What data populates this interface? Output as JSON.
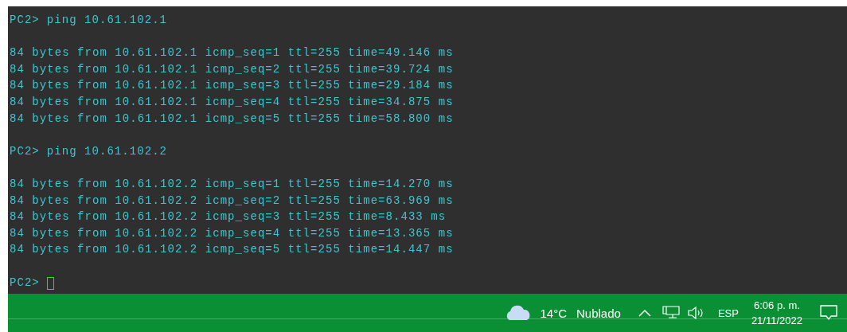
{
  "terminal": {
    "sessions": [
      {
        "prompt": "PC2>",
        "command": "ping 10.61.102.1",
        "replies": [
          "84 bytes from 10.61.102.1 icmp_seq=1 ttl=255 time=49.146 ms",
          "84 bytes from 10.61.102.1 icmp_seq=2 ttl=255 time=39.724 ms",
          "84 bytes from 10.61.102.1 icmp_seq=3 ttl=255 time=29.184 ms",
          "84 bytes from 10.61.102.1 icmp_seq=4 ttl=255 time=34.875 ms",
          "84 bytes from 10.61.102.1 icmp_seq=5 ttl=255 time=58.800 ms"
        ]
      },
      {
        "prompt": "PC2>",
        "command": "ping 10.61.102.2",
        "replies": [
          "84 bytes from 10.61.102.2 icmp_seq=1 ttl=255 time=14.270 ms",
          "84 bytes from 10.61.102.2 icmp_seq=2 ttl=255 time=63.969 ms",
          "84 bytes from 10.61.102.2 icmp_seq=3 ttl=255 time=8.433 ms",
          "84 bytes from 10.61.102.2 icmp_seq=4 ttl=255 time=13.365 ms",
          "84 bytes from 10.61.102.2 icmp_seq=5 ttl=255 time=14.447 ms"
        ]
      }
    ],
    "final_prompt": "PC2>"
  },
  "taskbar": {
    "weather": {
      "temperature": "14°C",
      "condition": "Nublado"
    },
    "language": "ESP",
    "time": "6:06 p. m.",
    "date": "21/11/2022"
  }
}
